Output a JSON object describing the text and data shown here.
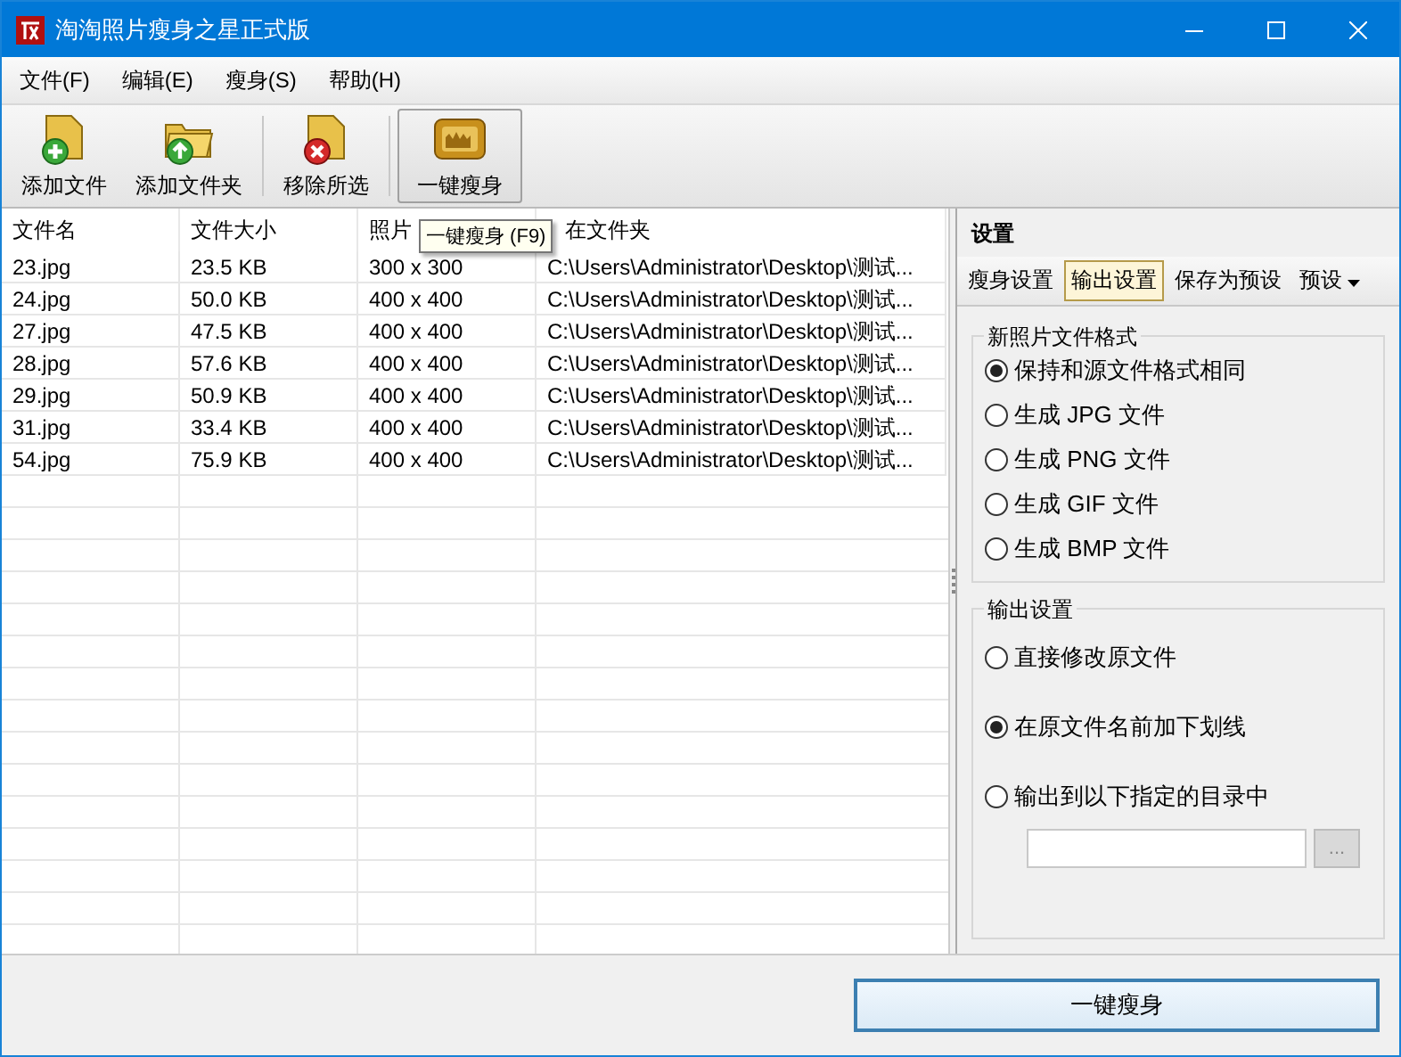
{
  "window": {
    "title": "淘淘照片瘦身之星正式版"
  },
  "menu": [
    "文件(F)",
    "编辑(E)",
    "瘦身(S)",
    "帮助(H)"
  ],
  "toolbar": [
    {
      "label": "添加文件",
      "kind": "add-file",
      "hovered": false
    },
    {
      "label": "添加文件夹",
      "kind": "add-folder",
      "hovered": false
    },
    {
      "label": "移除所选",
      "kind": "remove",
      "hovered": false
    },
    {
      "label": "一键瘦身",
      "kind": "slim",
      "hovered": true
    }
  ],
  "tooltip": "一键瘦身 (F9)",
  "table": {
    "columns": [
      "文件名",
      "文件大小",
      "照片",
      "在文件夹"
    ],
    "rows": [
      [
        "23.jpg",
        "23.5 KB",
        "300 x 300",
        "C:\\Users\\Administrator\\Desktop\\测试..."
      ],
      [
        "24.jpg",
        "50.0 KB",
        "400 x 400",
        "C:\\Users\\Administrator\\Desktop\\测试..."
      ],
      [
        "27.jpg",
        "47.5 KB",
        "400 x 400",
        "C:\\Users\\Administrator\\Desktop\\测试..."
      ],
      [
        "28.jpg",
        "57.6 KB",
        "400 x 400",
        "C:\\Users\\Administrator\\Desktop\\测试..."
      ],
      [
        "29.jpg",
        "50.9 KB",
        "400 x 400",
        "C:\\Users\\Administrator\\Desktop\\测试..."
      ],
      [
        "31.jpg",
        "33.4 KB",
        "400 x 400",
        "C:\\Users\\Administrator\\Desktop\\测试..."
      ],
      [
        "54.jpg",
        "75.9 KB",
        "400 x 400",
        "C:\\Users\\Administrator\\Desktop\\测试..."
      ]
    ]
  },
  "settings": {
    "title": "设置",
    "tabs": [
      {
        "label": "瘦身设置",
        "kind": "tab",
        "selected": false
      },
      {
        "label": "输出设置",
        "kind": "tab",
        "selected": true
      },
      {
        "label": "保存为预设",
        "kind": "tab",
        "selected": false
      },
      {
        "label": "预设",
        "kind": "dropdown",
        "selected": false
      }
    ],
    "groups": [
      {
        "title": "新照片文件格式",
        "options": [
          {
            "label": "保持和源文件格式相同",
            "selected": true
          },
          {
            "label": "生成 JPG 文件",
            "selected": false
          },
          {
            "label": "生成 PNG 文件",
            "selected": false
          },
          {
            "label": "生成 GIF 文件",
            "selected": false
          },
          {
            "label": "生成 BMP 文件",
            "selected": false
          }
        ]
      },
      {
        "title": "输出设置",
        "options": [
          {
            "label": "直接修改原文件",
            "selected": false
          },
          {
            "label": "在原文件名前加下划线",
            "selected": true
          },
          {
            "label": "输出到以下指定的目录中",
            "selected": false
          }
        ],
        "browse_button": "..."
      }
    ]
  },
  "bottom_button": "一键瘦身"
}
